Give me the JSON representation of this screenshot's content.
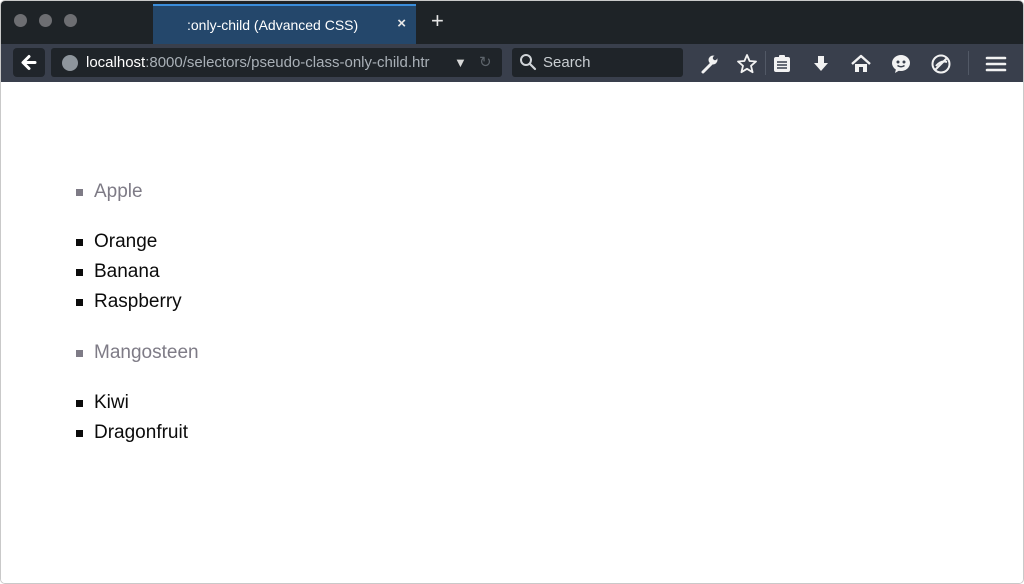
{
  "window": {
    "tab_title": ":only-child (Advanced CSS)",
    "tab_close": "×",
    "new_tab": "+"
  },
  "navbar": {
    "url_host": "localhost",
    "url_rest": ":8000/selectors/pseudo-class-only-child.htr",
    "search_placeholder": "Search"
  },
  "toolbar_icons": [
    "wrench-icon",
    "star-icon",
    "reading-list-icon",
    "download-icon",
    "home-icon",
    "chat-icon",
    "privacy-icon",
    "menu-icon"
  ],
  "page": {
    "items": [
      {
        "label": "Apple",
        "only_child": true
      },
      {
        "label": "Orange",
        "only_child": false
      },
      {
        "label": "Banana",
        "only_child": false
      },
      {
        "label": "Raspberry",
        "only_child": false
      },
      {
        "label": "Mangosteen",
        "only_child": true
      },
      {
        "label": "Kiwi",
        "only_child": false
      },
      {
        "label": "Dragonfruit",
        "only_child": false
      }
    ],
    "colors": {
      "only_child": "#7e7b86",
      "default": "#0b0b0b"
    }
  }
}
